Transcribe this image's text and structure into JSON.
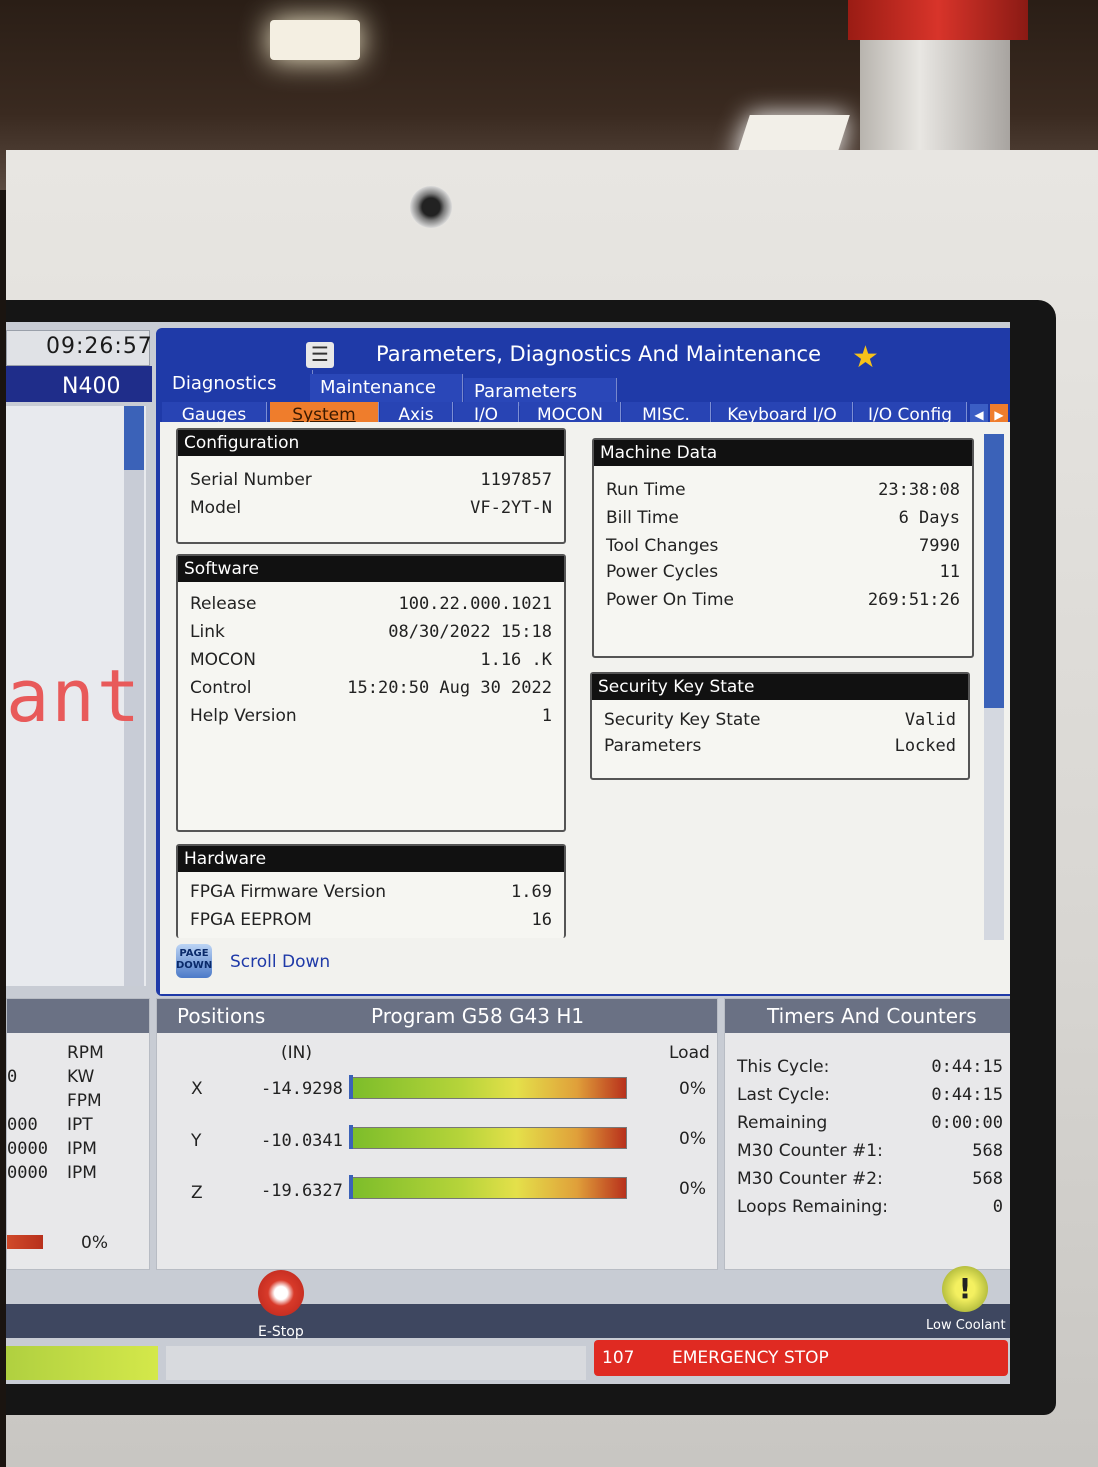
{
  "status": {
    "time": "09:26:57",
    "line": "N400",
    "partial_text": "ant"
  },
  "panel": {
    "title": "Parameters, Diagnostics And Maintenance",
    "tabs_top": [
      "Diagnostics",
      "Maintenance",
      "Parameters"
    ],
    "tabs_sub": [
      "Gauges",
      "System",
      "Axis",
      "I/O",
      "MOCON",
      "MISC.",
      "Keyboard I/O",
      "I/O Config"
    ],
    "active_sub": "System"
  },
  "configuration": {
    "title": "Configuration",
    "rows": [
      {
        "k": "Serial Number",
        "v": "1197857"
      },
      {
        "k": "Model",
        "v": "VF-2YT-N"
      }
    ]
  },
  "software": {
    "title": "Software",
    "rows": [
      {
        "k": "Release",
        "v": "100.22.000.1021"
      },
      {
        "k": "Link",
        "v": "08/30/2022 15:18"
      },
      {
        "k": "MOCON",
        "v": "1.16  .K"
      },
      {
        "k": "Control",
        "v": "15:20:50  Aug 30 2022"
      },
      {
        "k": "Help Version",
        "v": "1"
      }
    ]
  },
  "hardware": {
    "title": "Hardware",
    "rows": [
      {
        "k": "FPGA Firmware Version",
        "v": "1.69"
      },
      {
        "k": "FPGA EEPROM",
        "v": "16"
      }
    ]
  },
  "machine_data": {
    "title": "Machine Data",
    "rows": [
      {
        "k": "Run Time",
        "v": "23:38:08"
      },
      {
        "k": "Bill Time",
        "v": "6 Days"
      },
      {
        "k": "Tool Changes",
        "v": "7990"
      },
      {
        "k": "Power Cycles",
        "v": "11"
      },
      {
        "k": "Power On Time",
        "v": "269:51:26"
      }
    ]
  },
  "security": {
    "title": "Security Key State",
    "rows": [
      {
        "k": "Security Key State",
        "v": "Valid"
      },
      {
        "k": "Parameters",
        "v": "Locked"
      }
    ]
  },
  "page_down": {
    "icon_text": "PAGE DOWN",
    "label": "Scroll Down"
  },
  "spindle": {
    "units": [
      "RPM",
      "KW",
      "FPM",
      "IPT",
      "IPM",
      "IPM"
    ],
    "values": [
      "0",
      "",
      "",
      "000",
      "0000",
      "0000"
    ],
    "load": "0%"
  },
  "positions": {
    "title": "Positions",
    "program": "Program G58 G43 H1",
    "unit_header": "(IN)",
    "load_header": "Load",
    "axes": [
      {
        "axis": "X",
        "value": "-14.9298",
        "load": "0%",
        "load_level": 0
      },
      {
        "axis": "Y",
        "value": "-10.0341",
        "load": "0%",
        "load_level": 0
      },
      {
        "axis": "Z",
        "value": "-19.6327",
        "load": "0%",
        "load_level": 0
      }
    ]
  },
  "timers": {
    "title": "Timers And Counters",
    "rows": [
      {
        "k": "This Cycle:",
        "v": "0:44:15"
      },
      {
        "k": "Last Cycle:",
        "v": "0:44:15"
      },
      {
        "k": "Remaining",
        "v": "0:00:00"
      },
      {
        "k": "M30 Counter #1:",
        "v": "568"
      },
      {
        "k": "M30 Counter #2:",
        "v": "568"
      },
      {
        "k": "Loops Remaining:",
        "v": "0"
      }
    ]
  },
  "bottom": {
    "estop_label": "E-Stop",
    "coolant_label": "Low Coolant",
    "alarm_code": "107",
    "alarm_text": "EMERGENCY STOP"
  },
  "colors": {
    "accent_blue": "#1f3aa8",
    "active_tab": "#ef7d2c",
    "alarm_red": "#e02a22"
  }
}
